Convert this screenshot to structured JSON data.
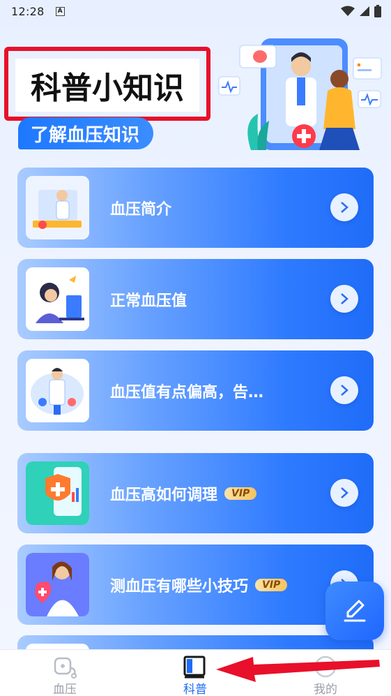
{
  "status_bar": {
    "time": "12:28",
    "sim_badge": "A"
  },
  "header": {
    "title": "科普小知识",
    "subtitle": "了解血压知识"
  },
  "cards": [
    {
      "label": "血压简介",
      "vip": "",
      "thumb_icon": "doctor-desk-illustration-icon"
    },
    {
      "label": "正常血压值",
      "vip": "",
      "thumb_icon": "woman-at-computer-illustration-icon"
    },
    {
      "label": "血压值有点偏高，告…",
      "vip": "",
      "thumb_icon": "doctor-standing-illustration-icon"
    },
    {
      "label": "血压高如何调理",
      "vip": "VIP",
      "thumb_icon": "medical-shield-illustration-icon"
    },
    {
      "label": "测血压有哪些小技巧",
      "vip": "VIP",
      "thumb_icon": "nurse-heart-illustration-icon"
    }
  ],
  "bottom_nav": {
    "items": [
      {
        "label": "血压",
        "icon": "stethoscope-icon",
        "active": false
      },
      {
        "label": "科普",
        "icon": "book-icon",
        "active": true
      },
      {
        "label": "我的",
        "icon": "profile-icon",
        "active": false
      }
    ]
  },
  "colors": {
    "accent": "#1f6cf8",
    "highlight_box": "#e8102a",
    "annotation_arrow": "#e8102a"
  }
}
